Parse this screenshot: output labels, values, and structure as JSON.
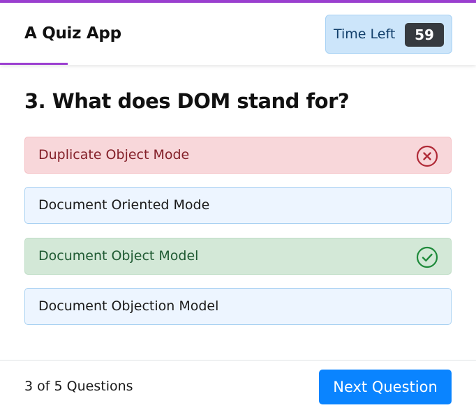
{
  "app": {
    "title": "A Quiz App",
    "accent_color": "#9b3fd0"
  },
  "timer": {
    "label": "Time Left",
    "value": "59"
  },
  "question": {
    "text": "3. What does DOM stand for?"
  },
  "options": [
    {
      "label": "Duplicate Object Mode",
      "state": "wrong",
      "icon": "x-circle-icon",
      "color": "#b02a37"
    },
    {
      "label": "Document Oriented Mode",
      "state": "neutral"
    },
    {
      "label": "Document Object Model",
      "state": "correct",
      "icon": "check-circle-icon",
      "color": "#1f8a3b"
    },
    {
      "label": "Document Objection Model",
      "state": "neutral"
    }
  ],
  "footer": {
    "counter_current": "3",
    "counter_of": "of",
    "counter_total": "5",
    "counter_suffix": "Questions",
    "next_label": "Next Question",
    "next_color": "#0a84ff"
  }
}
